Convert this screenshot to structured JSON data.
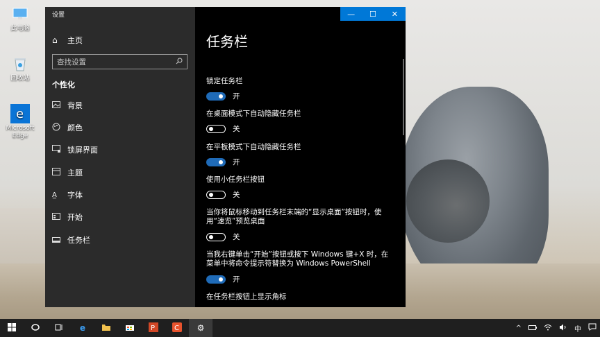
{
  "desktop": {
    "icons": [
      {
        "label": "此电脑"
      },
      {
        "label": "回收站"
      },
      {
        "label": "Microsoft Edge"
      }
    ]
  },
  "window": {
    "title": "设置",
    "controls": {
      "minimize": "—",
      "maximize": "☐",
      "close": "✕"
    }
  },
  "sidebar": {
    "home": "主页",
    "search_placeholder": "查找设置",
    "category": "个性化",
    "items": [
      {
        "label": "背景",
        "icon": "image-icon"
      },
      {
        "label": "颜色",
        "icon": "palette-icon"
      },
      {
        "label": "锁屏界面",
        "icon": "lockscreen-icon"
      },
      {
        "label": "主题",
        "icon": "theme-icon"
      },
      {
        "label": "字体",
        "icon": "font-icon"
      },
      {
        "label": "开始",
        "icon": "start-icon"
      },
      {
        "label": "任务栏",
        "icon": "taskbar-icon"
      }
    ]
  },
  "main": {
    "title": "任务栏",
    "options": [
      {
        "label": "锁定任务栏",
        "state": "开",
        "on": true
      },
      {
        "label": "在桌面模式下自动隐藏任务栏",
        "state": "关",
        "on": false
      },
      {
        "label": "在平板模式下自动隐藏任务栏",
        "state": "开",
        "on": true
      },
      {
        "label": "使用小任务栏按钮",
        "state": "关",
        "on": false
      },
      {
        "label": "当你将鼠标移动到任务栏末端的“显示桌面”按钮时，使用“速览”预览桌面",
        "state": "关",
        "on": false
      },
      {
        "label": "当我右键单击“开始”按钮或按下 Windows 键+X 时，在菜单中将命令提示符替换为 Windows PowerShell",
        "state": "开",
        "on": true
      },
      {
        "label": "在任务栏按钮上显示角标"
      }
    ]
  },
  "taskbar": {
    "tray_ime": "中",
    "tray_chevron": "^"
  },
  "colors": {
    "accent": "#0078d7",
    "toggle_on": "#1f6bb8",
    "sidebar_bg": "#2b2b2b",
    "content_bg": "#000000"
  }
}
